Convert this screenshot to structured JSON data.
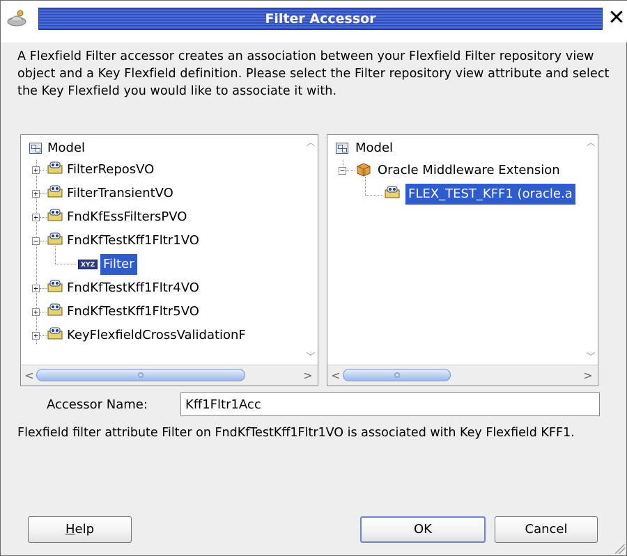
{
  "window": {
    "title": "Filter Accessor",
    "close_glyph": "✕",
    "app_icon": "app-icon"
  },
  "description": "A Flexfield Filter accessor creates an association between your Flexfield Filter repository view object and a Key Flexfield definition.  Please select the Filter repository view attribute and select the Key Flexfield you would like to associate it with.",
  "left_tree": {
    "root": "Model",
    "items": [
      {
        "label": "FilterReposVO",
        "expanded": false
      },
      {
        "label": "FilterTransientVO",
        "expanded": false
      },
      {
        "label": "FndKfEssFiltersPVO",
        "expanded": false
      },
      {
        "label": "FndKfTestKff1Fltr1VO",
        "expanded": true
      },
      {
        "label": "Filter",
        "selected": true,
        "icon_text": "XYZ"
      },
      {
        "label": "FndKfTestKff1Fltr4VO",
        "expanded": false
      },
      {
        "label": "FndKfTestKff1Fltr5VO",
        "expanded": false
      },
      {
        "label": "KeyFlexfieldCrossValidationF",
        "expanded": false
      }
    ]
  },
  "right_tree": {
    "root": "Model",
    "items": [
      {
        "label": "Oracle Middleware Extension",
        "expanded": true
      },
      {
        "label": "FLEX_TEST_KFF1 (oracle.a",
        "selected": true
      }
    ]
  },
  "accessor": {
    "label": "Accessor Name:",
    "value": "Kff1Fltr1Acc"
  },
  "info": "Flexfield filter attribute Filter on FndKfTestKff1Fltr1VO is associated with Key Flexfield KFF1.",
  "buttons": {
    "help_mnemonic": "H",
    "help_rest": "elp",
    "ok": "OK",
    "cancel": "Cancel"
  },
  "colors": {
    "title_bar": "#2f4fbf",
    "selection": "#2f5bd0",
    "dialog_bg": "#eeeeee"
  }
}
